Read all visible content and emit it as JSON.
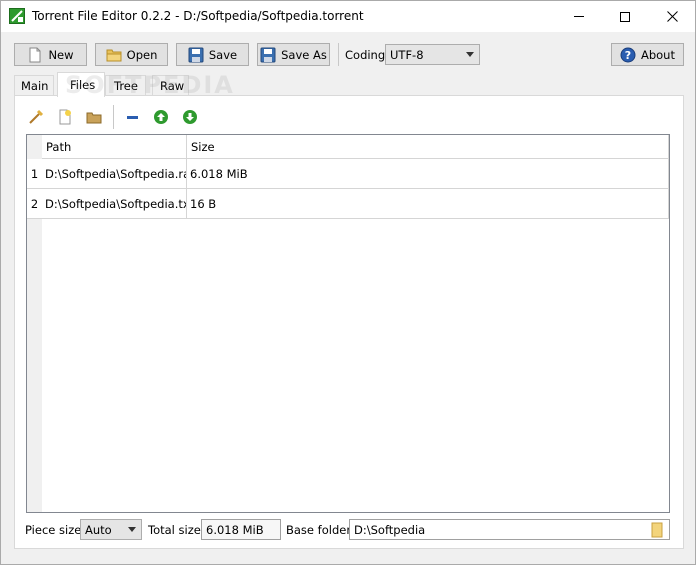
{
  "window": {
    "title": "Torrent File Editor 0.2.2 - D:/Softpedia/Softpedia.torrent"
  },
  "toolbar": {
    "new_label": "New",
    "open_label": "Open",
    "save_label": "Save",
    "save_as_label": "Save As",
    "coding_label": "Coding",
    "coding_value": "UTF-8",
    "about_label": "About"
  },
  "tabs": [
    {
      "label": "Main",
      "active": false
    },
    {
      "label": "Files",
      "active": true
    },
    {
      "label": "Tree",
      "active": false
    },
    {
      "label": "Raw",
      "active": false
    }
  ],
  "files_toolbar": {
    "icons": [
      "edit-icon",
      "add-file-icon",
      "add-folder-icon",
      "remove-icon",
      "move-up-icon",
      "move-down-icon"
    ]
  },
  "table": {
    "headers": [
      "Path",
      "Size"
    ],
    "rows": [
      {
        "num": "1",
        "path": "D:\\Softpedia\\Softpedia.rar",
        "size": "6.018 MiB"
      },
      {
        "num": "2",
        "path": "D:\\Softpedia\\Softpedia.txt",
        "size": "16 B"
      }
    ]
  },
  "footer": {
    "piece_size_label": "Piece size",
    "piece_size_value": "Auto",
    "total_size_label": "Total size",
    "total_size_value": "6.018 MiB",
    "base_folder_label": "Base folder",
    "base_folder_value": "D:\\Softpedia"
  },
  "watermark": "SOFTPEDIA",
  "colors": {
    "accent_green": "#2e9a2e",
    "help_blue": "#2a5db0",
    "folder_yellow": "#e8c15a"
  }
}
